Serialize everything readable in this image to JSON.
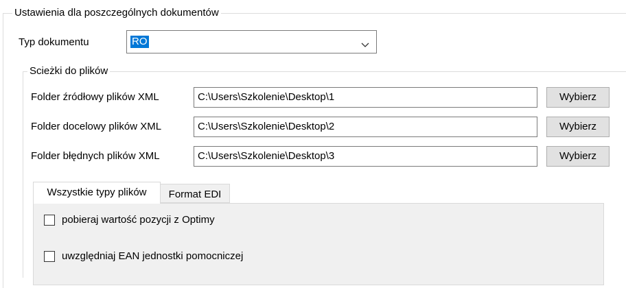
{
  "document_settings": {
    "title": "Ustawienia dla poszczególnych dokumentów",
    "doc_type_label": "Typ dokumentu",
    "doc_type_value": "RO"
  },
  "paths": {
    "title": "Scieżki do plików",
    "rows": [
      {
        "label": "Folder źródłowy plików XML",
        "value": "C:\\Users\\Szkolenie\\Desktop\\1",
        "button": "Wybierz"
      },
      {
        "label": "Folder docelowy plików XML",
        "value": "C:\\Users\\Szkolenie\\Desktop\\2",
        "button": "Wybierz"
      },
      {
        "label": "Folder błędnych plików XML",
        "value": "C:\\Users\\Szkolenie\\Desktop\\3",
        "button": "Wybierz"
      }
    ]
  },
  "tabs": [
    {
      "label": "Wszystkie typy plików"
    },
    {
      "label": "Format EDI"
    }
  ],
  "options": [
    {
      "label": "pobieraj wartość pozycji z Optimy",
      "checked": false
    },
    {
      "label": "uwzględniaj EAN jednostki pomocniczej",
      "checked": false
    }
  ],
  "colors": {
    "selection": "#0078d7",
    "button_bg": "#e1e1e1",
    "panel_bg": "#f0f0f0"
  },
  "icons": {
    "dropdown": "chevron-down-icon"
  }
}
